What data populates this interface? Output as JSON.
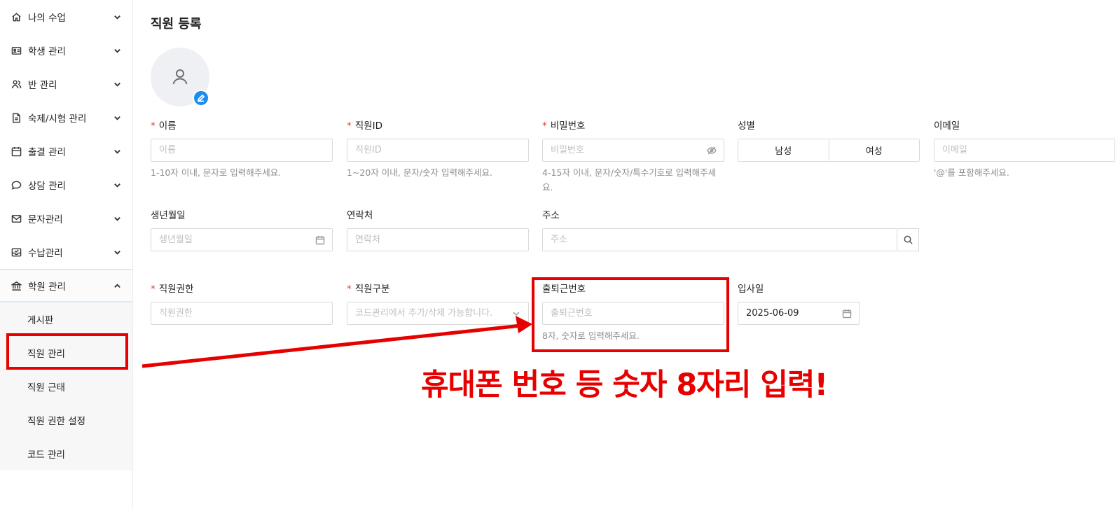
{
  "sidebar": {
    "items": [
      {
        "label": "나의 수업",
        "icon": "home-icon"
      },
      {
        "label": "학생 관리",
        "icon": "id-card-icon"
      },
      {
        "label": "반 관리",
        "icon": "users-icon"
      },
      {
        "label": "숙제/시험 관리",
        "icon": "document-icon"
      },
      {
        "label": "출결 관리",
        "icon": "calendar-icon"
      },
      {
        "label": "상담 관리",
        "icon": "chat-icon"
      },
      {
        "label": "문자관리",
        "icon": "mail-icon"
      },
      {
        "label": "수납관리",
        "icon": "inbox-icon"
      },
      {
        "label": "학원 관리",
        "icon": "bank-icon"
      }
    ],
    "submenu": [
      "게시판",
      "직원 관리",
      "직원 근태",
      "직원 권한 설정",
      "코드 관리"
    ]
  },
  "page": {
    "title": "직원 등록"
  },
  "form": {
    "name": {
      "label": "이름",
      "placeholder": "이름",
      "help": "1-10자 이내, 문자로 입력해주세요."
    },
    "staff_id": {
      "label": "직원ID",
      "placeholder": "직원ID",
      "help": "1~20자 이내, 문자/숫자 입력해주세요."
    },
    "password": {
      "label": "비밀번호",
      "placeholder": "비밀번호",
      "help": "4-15자 이내, 문자/숫자/특수기호로 입력해주세요."
    },
    "gender": {
      "label": "성별",
      "options": [
        "남성",
        "여성"
      ]
    },
    "email": {
      "label": "이메일",
      "placeholder": "이메일",
      "help": "'@'를 포함해주세요."
    },
    "birthdate": {
      "label": "생년월일",
      "placeholder": "생년월일"
    },
    "contact": {
      "label": "연락처",
      "placeholder": "연락처"
    },
    "address": {
      "label": "주소",
      "placeholder": "주소"
    },
    "role": {
      "label": "직원권한",
      "placeholder": "직원권한"
    },
    "category": {
      "label": "직원구분",
      "placeholder": "코드관리에서 추가/삭제 가능합니다."
    },
    "attendance_no": {
      "label": "출퇴근번호",
      "placeholder": "출퇴근번호",
      "help": "8자, 숫자로 입력해주세요."
    },
    "join_date": {
      "label": "입사일",
      "value": "2025-06-09"
    }
  },
  "annotation": {
    "text": "휴대폰 번호 등 숫자 8자리 입력!",
    "color": "#e60000"
  },
  "colors": {
    "accent": "#1a8df0",
    "required": "#e53935"
  }
}
